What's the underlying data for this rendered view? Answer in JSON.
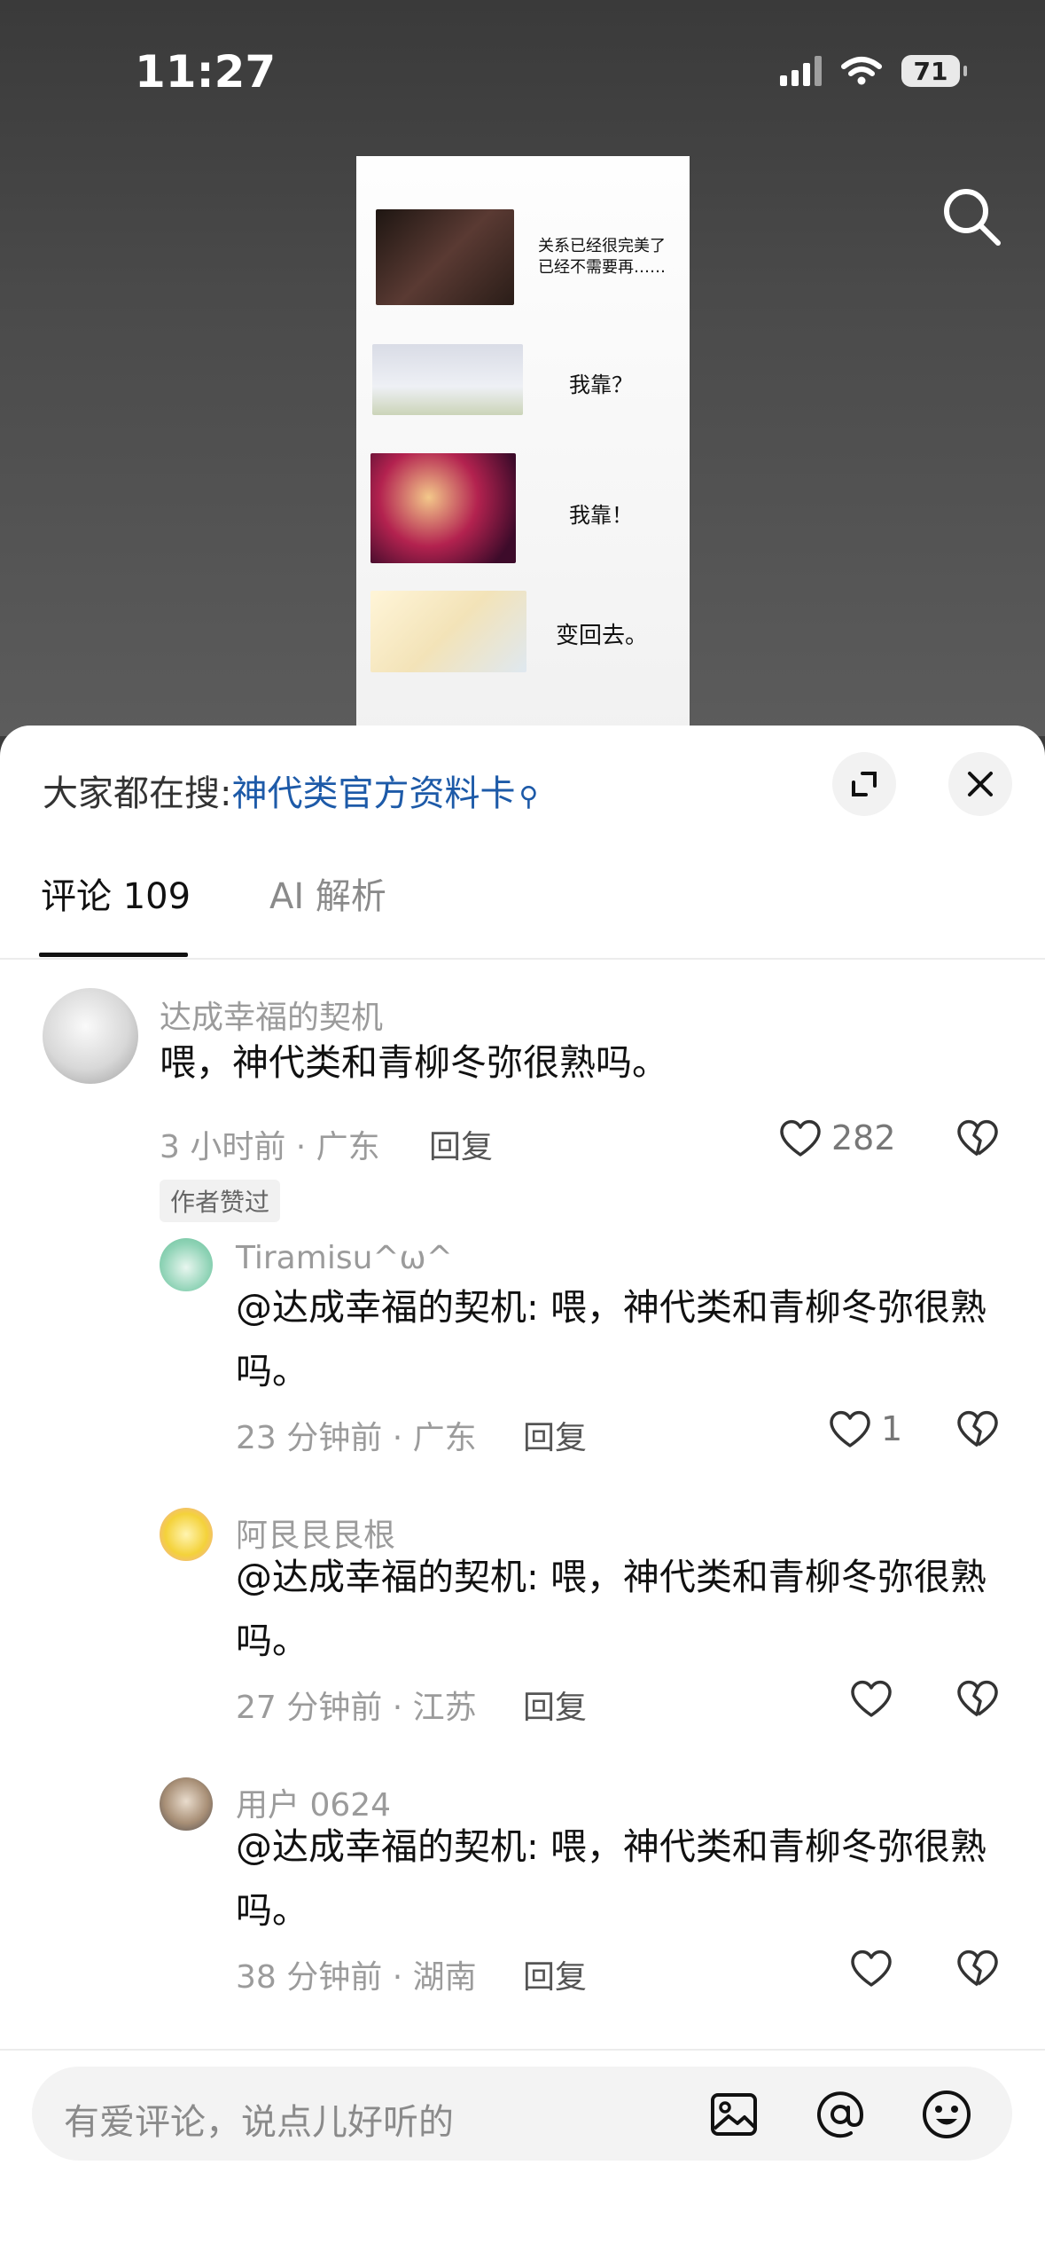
{
  "status_bar": {
    "time": "11:27",
    "battery": "71"
  },
  "comic": {
    "panels": [
      {
        "caption": "关系已经很完美了\n已经不需要再……"
      },
      {
        "caption": "我靠？"
      },
      {
        "caption": "我靠！"
      },
      {
        "caption": "变回去。"
      }
    ]
  },
  "hot_search": {
    "prefix": "大家都在搜:",
    "keyword": "神代类官方资料卡"
  },
  "tabs": {
    "comments": "评论 109",
    "ai": "AI 解析"
  },
  "comments": [
    {
      "username": "达成幸福的契机",
      "text": "喂，神代类和青柳冬弥很熟吗。",
      "meta": "3 小时前 · 广东",
      "reply": "回复",
      "likes": "282",
      "badge": "作者赞过"
    },
    {
      "username": "Tiramisu^ω^",
      "text": "@达成幸福的契机: 喂，神代类和青柳冬弥很熟吗。",
      "meta": "23 分钟前 · 广东",
      "reply": "回复",
      "likes": "1"
    },
    {
      "username": "阿艮艮艮根",
      "text": "@达成幸福的契机: 喂，神代类和青柳冬弥很熟吗。",
      "meta": "27 分钟前 · 江苏",
      "reply": "回复",
      "likes": ""
    },
    {
      "username": "用户 0624",
      "text": "@达成幸福的契机: 喂，神代类和青柳冬弥很熟吗。",
      "meta": "38 分钟前 · 湖南",
      "reply": "回复",
      "likes": ""
    }
  ],
  "input": {
    "placeholder": "有爱评论，说点儿好听的"
  },
  "icons": {
    "search": "search-icon",
    "expand": "expand-icon",
    "close": "close-icon",
    "like": "heart-icon",
    "dislike": "broken-heart-icon",
    "image": "image-icon",
    "at": "at-icon",
    "emoji": "emoji-icon"
  },
  "colors": {
    "link": "#1d5aa8",
    "sheet": "#ffffff",
    "muted": "#9b9b9b"
  }
}
